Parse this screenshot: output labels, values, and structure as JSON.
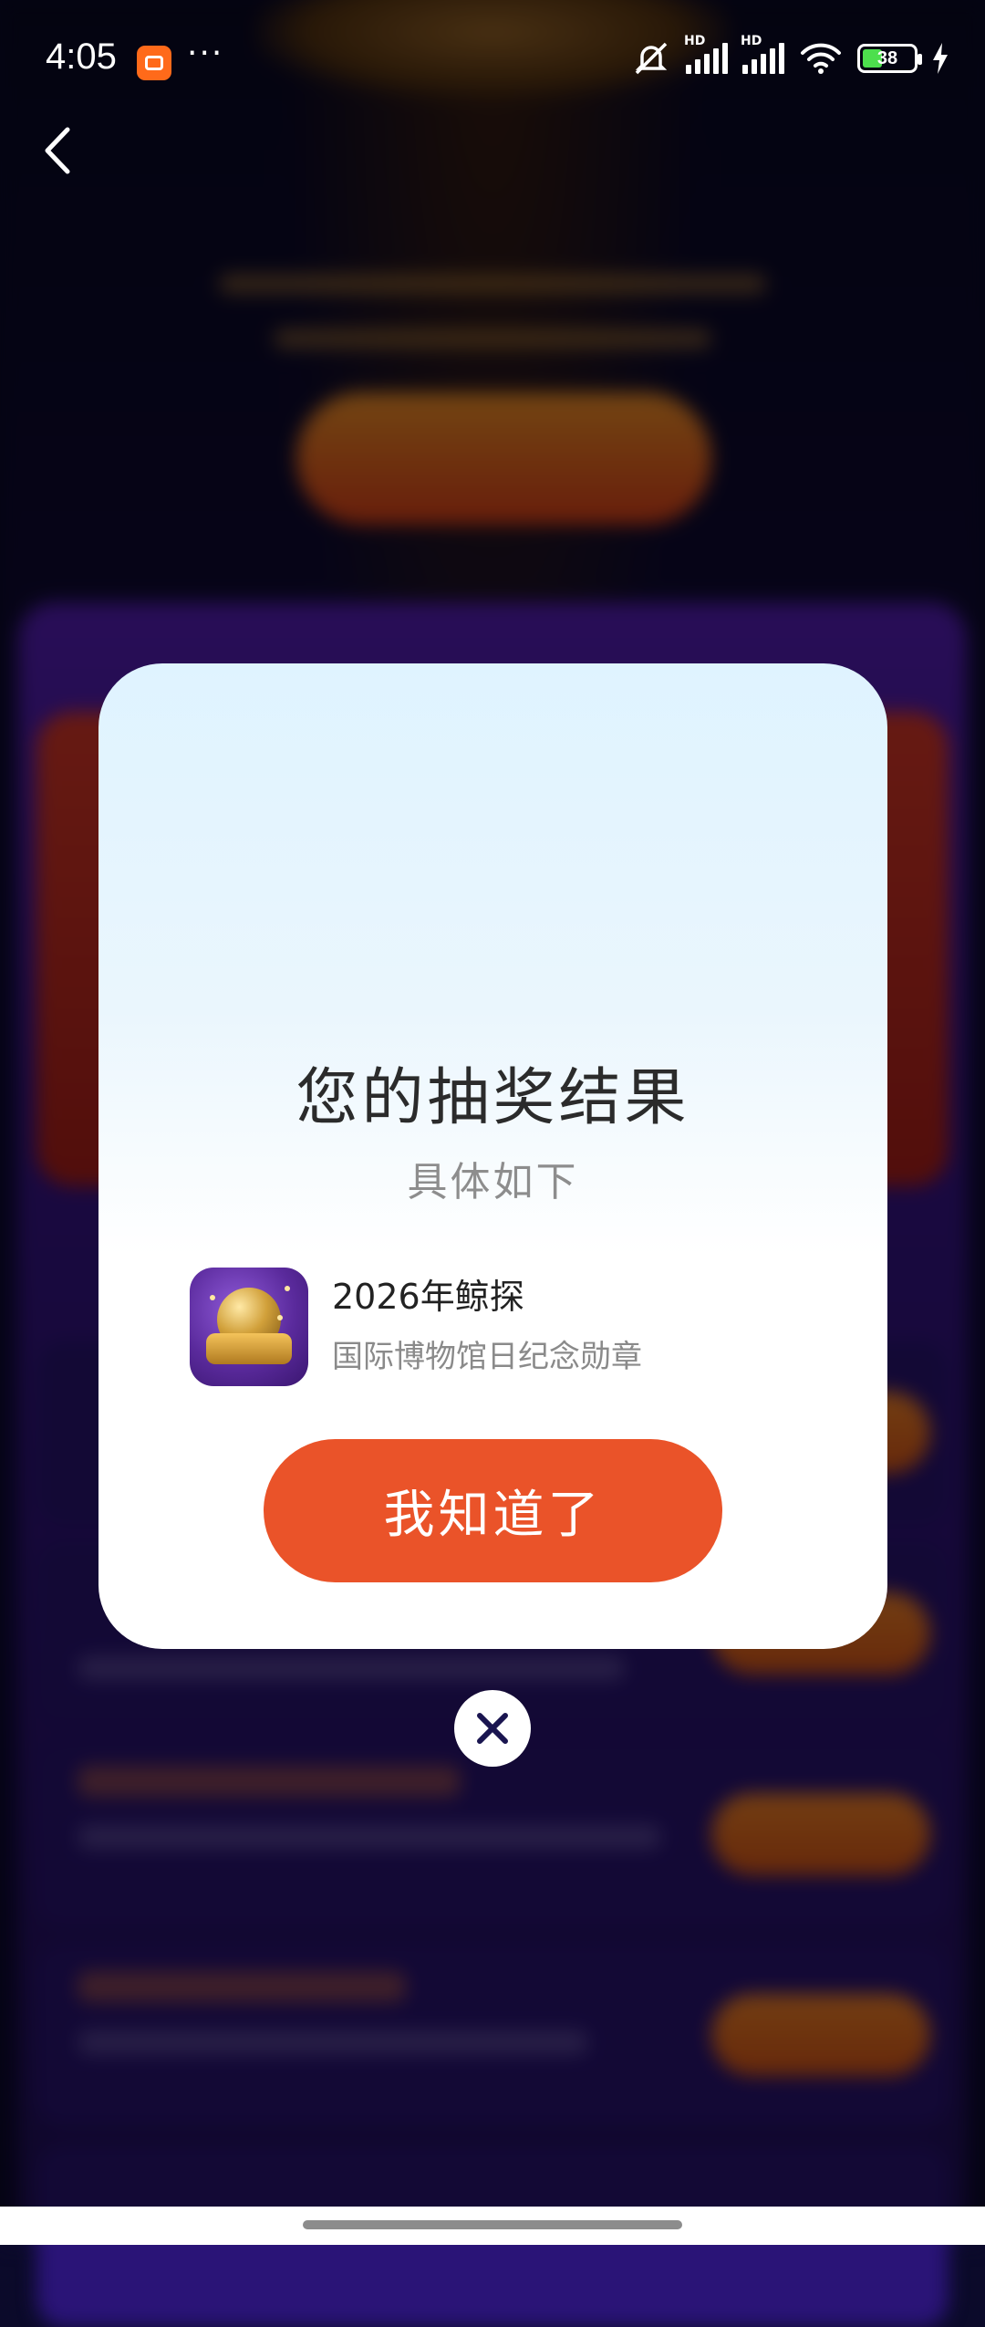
{
  "status_bar": {
    "time": "4:05",
    "more": "···",
    "battery_percent": "38",
    "battery_level": 0.38,
    "network_label": "HD"
  },
  "modal": {
    "title": "您的抽奖结果",
    "subtitle": "具体如下",
    "prize": {
      "name": "2026年鲸探",
      "description": "国际博物馆日纪念勋章"
    },
    "confirm_label": "我知道了"
  },
  "colors": {
    "accent": "#ea5329",
    "modal_top": "#dff3ff",
    "overlay": "#0b0a2a"
  },
  "icons": {
    "back": "chevron-left-icon",
    "close": "close-icon",
    "wifi": "wifi-icon",
    "charging": "lightning-icon",
    "mute": "bell-off-icon"
  }
}
